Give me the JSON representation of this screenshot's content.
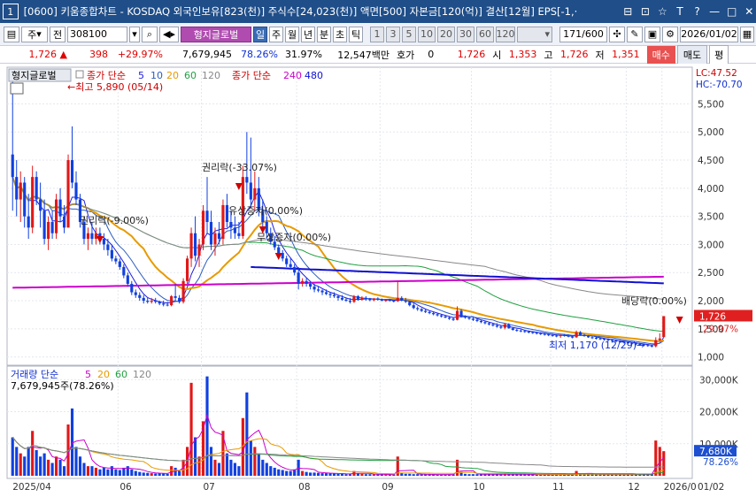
{
  "window": {
    "num": "1",
    "title": "[0600] 키움종합차트 - KOSDAQ 외국인보유[823(천)] 주식수[24,023(천)] 액면[500] 자본금[120(억)] 결산[12월] EPS[-1,·"
  },
  "toolbar": {
    "stock_type": "주",
    "market": "전",
    "code": "308100",
    "indicator_name": "형지글로벌",
    "periods": [
      "일",
      "주",
      "월",
      "년",
      "분",
      "초",
      "틱"
    ],
    "intervals": [
      "1",
      "3",
      "5",
      "10",
      "20",
      "30",
      "60",
      "120"
    ],
    "count": "171",
    "count_total": "/600",
    "date": "2026/01/02"
  },
  "pricebar": {
    "price": "1,726",
    "change": "398",
    "change_pct": "+29.97%",
    "volume": "7,679,945",
    "vol_ratio": "78.26%",
    "turnover": "31.97%",
    "amount": "12,547백만",
    "quote_label": "호가",
    "quote_value": "0",
    "ask": "1,726",
    "start_label": "시",
    "start": "1,353",
    "high_label": "고",
    "high": "1,726",
    "low_label": "저",
    "low": "1,351",
    "buy": "매수",
    "sell": "매도",
    "avg": "평"
  },
  "legend": {
    "stock": "형지글로벌",
    "price_label": "종가 단순",
    "ma_periods": [
      "5",
      "10",
      "20",
      "60",
      "120"
    ],
    "ma_colors": [
      "#1e1ee0",
      "#2a5cc0",
      "#e89a00",
      "#20a040",
      "#888888"
    ],
    "ma_long_label": "종가 단순",
    "ma_long": [
      "240",
      "480"
    ],
    "ma_long_colors": [
      "#cc00cc",
      "#1010d0"
    ],
    "lc": "LC:47.52",
    "hc": "HC:-70.70"
  },
  "volume_legend": {
    "label": "거래량 단순",
    "ma_periods": [
      "5",
      "20",
      "60",
      "120"
    ],
    "ma_colors": [
      "#cc00cc",
      "#e89a00",
      "#20a040",
      "#888888"
    ],
    "value": "7,679,945주(78.26%)"
  },
  "annotations": [
    {
      "text": "←최고 5,890 (05/14)",
      "color": "#cc0000"
    },
    {
      "text": "권리락(-9.00%)",
      "color": "#222222"
    },
    {
      "text": "권리락(-33.07%)",
      "color": "#222222"
    },
    {
      "text": "유상증자(0.00%)",
      "color": "#222222"
    },
    {
      "text": "무상증자(0.00%)",
      "color": "#222222"
    },
    {
      "text": "배당락(0.00%)",
      "color": "#222222"
    },
    {
      "text": "최저 1,170 (12/29)→",
      "color": "#1030d0"
    }
  ],
  "price_axis": {
    "labels": [
      "5,500",
      "5,000",
      "4,500",
      "4,000",
      "3,500",
      "3,000",
      "2,500",
      "2,000",
      "1,500",
      "1,000"
    ],
    "current": "1,726",
    "current_pct": "29.97%"
  },
  "volume_axis": {
    "labels": [
      "30,000K",
      "20,000K",
      "10,000K"
    ],
    "current": "7,680K",
    "current_pct": "78.26%"
  },
  "date_axis": [
    "2025/04",
    "06",
    "07",
    "08",
    "09",
    "10",
    "11",
    "12",
    "2026/0",
    "01/02"
  ],
  "chart_data": {
    "type": "candlestick",
    "price_range": [
      900,
      5900
    ],
    "volume_range": [
      0,
      32000
    ],
    "volume_unit": "K",
    "candles": [
      [
        4600,
        5890,
        3600,
        4200,
        12000
      ],
      [
        4200,
        4500,
        3500,
        3800,
        9000
      ],
      [
        3800,
        4300,
        3400,
        4100,
        7000
      ],
      [
        4100,
        4200,
        3300,
        3500,
        6000
      ],
      [
        3500,
        3900,
        3100,
        3300,
        9000
      ],
      [
        3300,
        4400,
        3200,
        4200,
        14000
      ],
      [
        4200,
        4300,
        3700,
        3800,
        8000
      ],
      [
        3800,
        4100,
        3300,
        3600,
        6000
      ],
      [
        3600,
        3800,
        3000,
        3100,
        7000
      ],
      [
        3100,
        3500,
        2900,
        3400,
        5000
      ],
      [
        3400,
        3600,
        3100,
        3200,
        4000
      ],
      [
        3200,
        3900,
        3100,
        3800,
        6000
      ],
      [
        3800,
        4000,
        3400,
        3500,
        5000
      ],
      [
        3500,
        3700,
        3200,
        3300,
        3000
      ],
      [
        3300,
        4600,
        3300,
        4500,
        16000
      ],
      [
        4500,
        5100,
        4000,
        4100,
        21000
      ],
      [
        4100,
        4300,
        3700,
        3800,
        9000
      ],
      [
        3800,
        3900,
        3300,
        3400,
        6000
      ],
      [
        3400,
        3500,
        3000,
        3100,
        4000
      ],
      [
        3100,
        3300,
        2900,
        3200,
        3000
      ],
      [
        3200,
        3400,
        3000,
        3100,
        3000
      ],
      [
        3100,
        3300,
        3000,
        3200,
        2500
      ],
      [
        3200,
        3300,
        3000,
        3100,
        2000
      ],
      [
        3100,
        3200,
        2900,
        3000,
        2500
      ],
      [
        3000,
        3100,
        2800,
        2900,
        2000
      ],
      [
        2900,
        3000,
        2700,
        2750,
        3000
      ],
      [
        2750,
        2800,
        2650,
        2700,
        2000
      ],
      [
        2700,
        2750,
        2550,
        2600,
        1800
      ],
      [
        2600,
        2650,
        2400,
        2450,
        2500
      ],
      [
        2450,
        2500,
        2250,
        2300,
        3000
      ],
      [
        2300,
        2350,
        2100,
        2150,
        2000
      ],
      [
        2150,
        2200,
        2050,
        2100,
        1500
      ],
      [
        2100,
        2150,
        2000,
        2050,
        1200
      ],
      [
        2050,
        2100,
        1950,
        2000,
        1000
      ],
      [
        2000,
        2050,
        1950,
        1980,
        900
      ],
      [
        1980,
        2050,
        1950,
        2000,
        800
      ],
      [
        2000,
        2050,
        1950,
        1980,
        700
      ],
      [
        1980,
        2000,
        1920,
        1950,
        800
      ],
      [
        1950,
        2000,
        1900,
        1930,
        700
      ],
      [
        1930,
        1980,
        1900,
        1920,
        600
      ],
      [
        1920,
        2100,
        1900,
        2080,
        3000
      ],
      [
        2080,
        2300,
        2000,
        2050,
        2500
      ],
      [
        2050,
        2100,
        1950,
        1980,
        1500
      ],
      [
        1980,
        2400,
        1950,
        2350,
        5000
      ],
      [
        2350,
        2800,
        2300,
        2750,
        9000
      ],
      [
        2750,
        3300,
        2600,
        3200,
        29000
      ],
      [
        3200,
        3500,
        2700,
        2800,
        12000
      ],
      [
        2800,
        3100,
        2600,
        3000,
        6000
      ],
      [
        3000,
        3700,
        2900,
        3600,
        17000
      ],
      [
        3600,
        4200,
        3200,
        3400,
        31000
      ],
      [
        3400,
        3600,
        2900,
        3000,
        9000
      ],
      [
        3000,
        3300,
        2800,
        3200,
        5000
      ],
      [
        3200,
        3400,
        3000,
        3100,
        4000
      ],
      [
        3100,
        3800,
        3000,
        3700,
        14000
      ],
      [
        3700,
        3900,
        3300,
        3400,
        7000
      ],
      [
        3400,
        3600,
        3100,
        3300,
        5000
      ],
      [
        3300,
        3500,
        3100,
        3200,
        4000
      ],
      [
        3200,
        3400,
        3100,
        3150,
        3000
      ],
      [
        3150,
        4400,
        3100,
        4200,
        18000
      ],
      [
        4200,
        5000,
        3900,
        4100,
        26000
      ],
      [
        4100,
        4900,
        3700,
        3800,
        11000
      ],
      [
        3800,
        4300,
        3600,
        4000,
        9000
      ],
      [
        4000,
        4200,
        3500,
        3600,
        7000
      ],
      [
        3600,
        3800,
        3300,
        3400,
        5000
      ],
      [
        3400,
        3500,
        3100,
        3200,
        4000
      ],
      [
        3200,
        3300,
        3000,
        3050,
        3000
      ],
      [
        3050,
        3150,
        2900,
        2950,
        2500
      ],
      [
        2950,
        3000,
        2800,
        2850,
        2000
      ],
      [
        2850,
        2900,
        2700,
        2750,
        1800
      ],
      [
        2750,
        2800,
        2600,
        2650,
        1500
      ],
      [
        2650,
        2750,
        2550,
        2600,
        1500
      ],
      [
        2600,
        2650,
        2450,
        2500,
        2000
      ],
      [
        2500,
        2600,
        2200,
        2300,
        5000
      ],
      [
        2300,
        2400,
        2250,
        2350,
        1500
      ],
      [
        2350,
        2400,
        2250,
        2300,
        1200
      ],
      [
        2300,
        2350,
        2200,
        2250,
        1000
      ],
      [
        2250,
        2300,
        2150,
        2200,
        1000
      ],
      [
        2200,
        2250,
        2150,
        2180,
        900
      ],
      [
        2180,
        2200,
        2100,
        2150,
        800
      ],
      [
        2150,
        2200,
        2100,
        2120,
        800
      ],
      [
        2120,
        2150,
        2050,
        2100,
        700
      ],
      [
        2100,
        2150,
        2050,
        2080,
        700
      ],
      [
        2080,
        2100,
        2000,
        2050,
        600
      ],
      [
        2050,
        2100,
        2000,
        2020,
        600
      ],
      [
        2020,
        2050,
        1980,
        2000,
        500
      ],
      [
        2000,
        2050,
        1950,
        1980,
        500
      ],
      [
        1980,
        2100,
        1960,
        2080,
        1500
      ],
      [
        2080,
        2100,
        2000,
        2020,
        700
      ],
      [
        2020,
        2080,
        2000,
        2050,
        600
      ],
      [
        2050,
        2080,
        2000,
        2030,
        500
      ],
      [
        2030,
        2050,
        1990,
        2010,
        500
      ],
      [
        2010,
        2050,
        1990,
        2040,
        500
      ],
      [
        2040,
        2060,
        2000,
        2020,
        400
      ],
      [
        2020,
        2040,
        1990,
        2000,
        400
      ],
      [
        2000,
        2030,
        1980,
        2010,
        400
      ],
      [
        2010,
        2030,
        1990,
        2000,
        400
      ],
      [
        2000,
        2020,
        1970,
        1990,
        400
      ],
      [
        1990,
        2350,
        1980,
        2050,
        6000
      ],
      [
        2050,
        2080,
        1990,
        2000,
        800
      ],
      [
        2000,
        2050,
        1960,
        1980,
        600
      ],
      [
        1980,
        2000,
        1900,
        1920,
        600
      ],
      [
        1920,
        1950,
        1850,
        1870,
        500
      ],
      [
        1870,
        1900,
        1820,
        1850,
        500
      ],
      [
        1850,
        1870,
        1800,
        1820,
        400
      ],
      [
        1820,
        1850,
        1780,
        1800,
        400
      ],
      [
        1800,
        1820,
        1760,
        1780,
        400
      ],
      [
        1780,
        1800,
        1740,
        1760,
        400
      ],
      [
        1760,
        1780,
        1720,
        1740,
        400
      ],
      [
        1740,
        1760,
        1700,
        1720,
        400
      ],
      [
        1720,
        1740,
        1690,
        1700,
        400
      ],
      [
        1700,
        1720,
        1660,
        1680,
        400
      ],
      [
        1680,
        1700,
        1640,
        1660,
        400
      ],
      [
        1660,
        1900,
        1650,
        1820,
        5000
      ],
      [
        1820,
        1850,
        1700,
        1720,
        1200
      ],
      [
        1720,
        1740,
        1680,
        1700,
        600
      ],
      [
        1700,
        1720,
        1660,
        1680,
        500
      ],
      [
        1680,
        1700,
        1640,
        1660,
        500
      ],
      [
        1660,
        1680,
        1620,
        1640,
        500
      ],
      [
        1640,
        1660,
        1600,
        1620,
        500
      ],
      [
        1620,
        1640,
        1580,
        1600,
        500
      ],
      [
        1600,
        1620,
        1560,
        1580,
        450
      ],
      [
        1580,
        1600,
        1540,
        1560,
        450
      ],
      [
        1560,
        1600,
        1520,
        1540,
        450
      ],
      [
        1540,
        1560,
        1500,
        1520,
        450
      ],
      [
        1520,
        1600,
        1490,
        1580,
        700
      ],
      [
        1580,
        1600,
        1500,
        1510,
        500
      ],
      [
        1510,
        1530,
        1470,
        1480,
        450
      ],
      [
        1480,
        1500,
        1450,
        1470,
        450
      ],
      [
        1470,
        1490,
        1440,
        1460,
        450
      ],
      [
        1460,
        1480,
        1430,
        1450,
        450
      ],
      [
        1450,
        1470,
        1420,
        1440,
        400
      ],
      [
        1440,
        1460,
        1410,
        1430,
        400
      ],
      [
        1430,
        1450,
        1400,
        1420,
        400
      ],
      [
        1420,
        1440,
        1390,
        1410,
        400
      ],
      [
        1410,
        1430,
        1380,
        1400,
        400
      ],
      [
        1400,
        1420,
        1370,
        1390,
        400
      ],
      [
        1390,
        1410,
        1360,
        1380,
        400
      ],
      [
        1380,
        1400,
        1350,
        1370,
        400
      ],
      [
        1370,
        1400,
        1340,
        1390,
        400
      ],
      [
        1390,
        1410,
        1360,
        1380,
        400
      ],
      [
        1380,
        1400,
        1350,
        1360,
        400
      ],
      [
        1360,
        1380,
        1330,
        1350,
        400
      ],
      [
        1350,
        1470,
        1340,
        1440,
        1500
      ],
      [
        1440,
        1460,
        1380,
        1390,
        700
      ],
      [
        1390,
        1410,
        1360,
        1370,
        500
      ],
      [
        1370,
        1390,
        1340,
        1350,
        450
      ],
      [
        1350,
        1370,
        1320,
        1340,
        450
      ],
      [
        1340,
        1360,
        1310,
        1330,
        450
      ],
      [
        1330,
        1350,
        1300,
        1320,
        450
      ],
      [
        1320,
        1340,
        1290,
        1310,
        450
      ],
      [
        1310,
        1330,
        1280,
        1300,
        450
      ],
      [
        1300,
        1320,
        1270,
        1290,
        450
      ],
      [
        1290,
        1310,
        1260,
        1280,
        450
      ],
      [
        1280,
        1300,
        1250,
        1270,
        450
      ],
      [
        1270,
        1290,
        1240,
        1260,
        450
      ],
      [
        1260,
        1280,
        1230,
        1250,
        450
      ],
      [
        1250,
        1270,
        1220,
        1240,
        450
      ],
      [
        1240,
        1260,
        1210,
        1230,
        450
      ],
      [
        1230,
        1250,
        1200,
        1220,
        450
      ],
      [
        1220,
        1240,
        1190,
        1210,
        450
      ],
      [
        1210,
        1230,
        1180,
        1200,
        450
      ],
      [
        1200,
        1220,
        1170,
        1190,
        500
      ],
      [
        1190,
        1350,
        1170,
        1300,
        11000
      ],
      [
        1300,
        1420,
        1280,
        1328,
        9000
      ],
      [
        1353,
        1726,
        1351,
        1726,
        7680
      ]
    ],
    "extra_candles": [
      [
        1330,
        1360,
        1300,
        1340,
        500
      ],
      [
        1340,
        1380,
        1320,
        1350,
        500
      ]
    ]
  }
}
